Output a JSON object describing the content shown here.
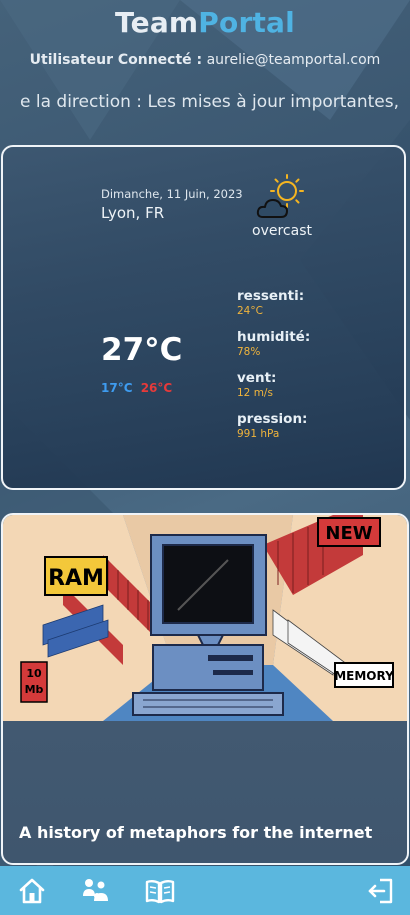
{
  "header": {
    "brand_part1": "Team",
    "brand_part2": "Portal",
    "user_label": "Utilisateur Connecté :",
    "user_email": "aurelie@teamportal.com",
    "ticker_text": "e la direction : Les mises à jour importantes,"
  },
  "weather": {
    "date": "Dimanche, 11 Juin, 2023",
    "location": "Lyon, FR",
    "icon": "sun-cloud-icon",
    "condition": "overcast",
    "temperature": "27°C",
    "temp_min": "17°C",
    "temp_max": "26°C",
    "stats": [
      {
        "label": "ressenti:",
        "value": "24°C"
      },
      {
        "label": "humidité:",
        "value": "78%"
      },
      {
        "label": "vent:",
        "value": "12 m/s"
      },
      {
        "label": "pression:",
        "value": "991 hPa"
      }
    ],
    "colors": {
      "min": "#3e9cf0",
      "max": "#e63a3a",
      "stat_value": "#f0b43c"
    }
  },
  "news": {
    "title": "A history of metaphors for the internet",
    "image_labels": {
      "ram": "RAM",
      "new": "NEW",
      "memory": "MEMORY",
      "size_num": "10",
      "size_unit": "Mb"
    }
  },
  "nav": {
    "items": [
      "home-icon",
      "team-icon",
      "book-icon",
      "logout-icon"
    ],
    "background": "#5bb7de"
  }
}
